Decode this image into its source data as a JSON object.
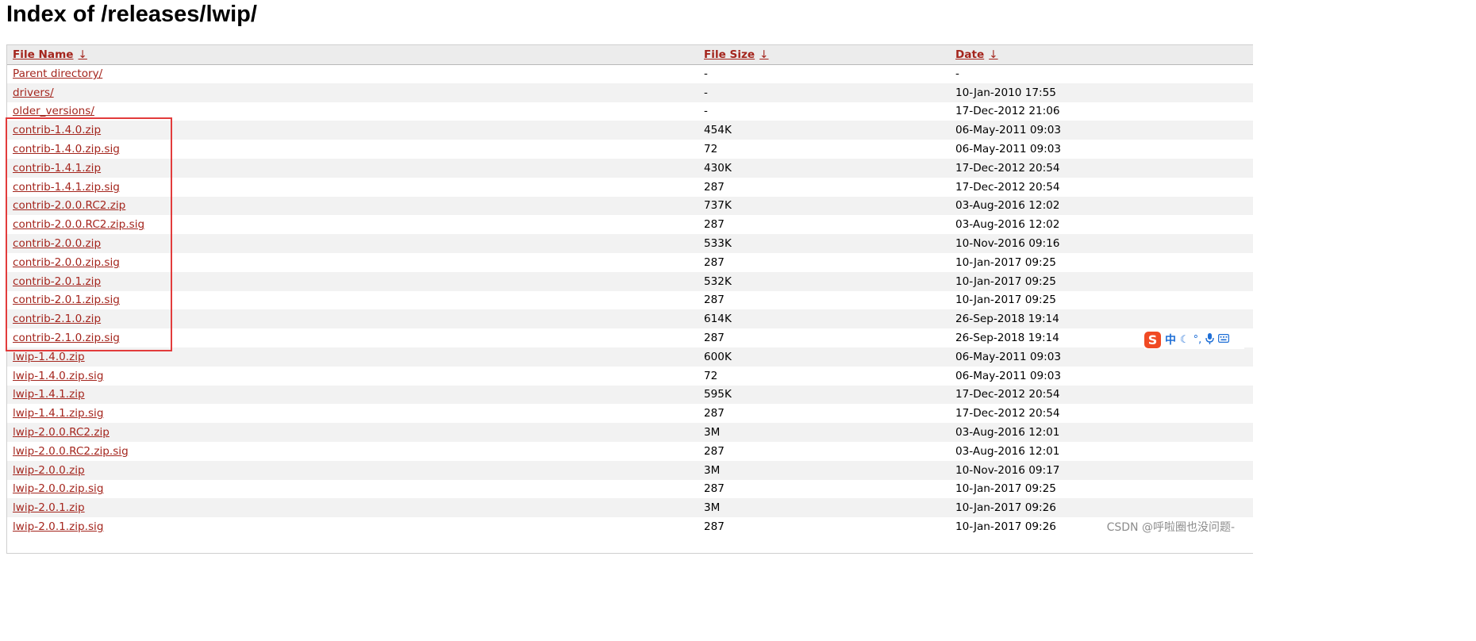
{
  "page": {
    "title": "Index of /releases/lwip/"
  },
  "table": {
    "headers": [
      {
        "label": "File Name",
        "arrow": "↓"
      },
      {
        "label": "File Size",
        "arrow": "↓"
      },
      {
        "label": "Date",
        "arrow": "↓"
      }
    ],
    "rows": [
      {
        "name": "Parent directory/",
        "size": "-",
        "date": "-"
      },
      {
        "name": "drivers/",
        "size": "-",
        "date": "10-Jan-2010 17:55"
      },
      {
        "name": "older_versions/",
        "size": "-",
        "date": "17-Dec-2012 21:06"
      },
      {
        "name": "contrib-1.4.0.zip",
        "size": "454K",
        "date": "06-May-2011 09:03"
      },
      {
        "name": "contrib-1.4.0.zip.sig",
        "size": "72",
        "date": "06-May-2011 09:03"
      },
      {
        "name": "contrib-1.4.1.zip",
        "size": "430K",
        "date": "17-Dec-2012 20:54"
      },
      {
        "name": "contrib-1.4.1.zip.sig",
        "size": "287",
        "date": "17-Dec-2012 20:54"
      },
      {
        "name": "contrib-2.0.0.RC2.zip",
        "size": "737K",
        "date": "03-Aug-2016 12:02"
      },
      {
        "name": "contrib-2.0.0.RC2.zip.sig",
        "size": "287",
        "date": "03-Aug-2016 12:02"
      },
      {
        "name": "contrib-2.0.0.zip",
        "size": "533K",
        "date": "10-Nov-2016 09:16"
      },
      {
        "name": "contrib-2.0.0.zip.sig",
        "size": "287",
        "date": "10-Jan-2017 09:25"
      },
      {
        "name": "contrib-2.0.1.zip",
        "size": "532K",
        "date": "10-Jan-2017 09:25"
      },
      {
        "name": "contrib-2.0.1.zip.sig",
        "size": "287",
        "date": "10-Jan-2017 09:25"
      },
      {
        "name": "contrib-2.1.0.zip",
        "size": "614K",
        "date": "26-Sep-2018 19:14"
      },
      {
        "name": "contrib-2.1.0.zip.sig",
        "size": "287",
        "date": "26-Sep-2018 19:14"
      },
      {
        "name": "lwip-1.4.0.zip",
        "size": "600K",
        "date": "06-May-2011 09:03"
      },
      {
        "name": "lwip-1.4.0.zip.sig",
        "size": "72",
        "date": "06-May-2011 09:03"
      },
      {
        "name": "lwip-1.4.1.zip",
        "size": "595K",
        "date": "17-Dec-2012 20:54"
      },
      {
        "name": "lwip-1.4.1.zip.sig",
        "size": "287",
        "date": "17-Dec-2012 20:54"
      },
      {
        "name": "lwip-2.0.0.RC2.zip",
        "size": "3M",
        "date": "03-Aug-2016 12:01"
      },
      {
        "name": "lwip-2.0.0.RC2.zip.sig",
        "size": "287",
        "date": "03-Aug-2016 12:01"
      },
      {
        "name": "lwip-2.0.0.zip",
        "size": "3M",
        "date": "10-Nov-2016 09:17"
      },
      {
        "name": "lwip-2.0.0.zip.sig",
        "size": "287",
        "date": "10-Jan-2017 09:25"
      },
      {
        "name": "lwip-2.0.1.zip",
        "size": "3M",
        "date": "10-Jan-2017 09:26"
      },
      {
        "name": "lwip-2.0.1.zip.sig",
        "size": "287",
        "date": "10-Jan-2017 09:26"
      }
    ]
  },
  "ime_toolbar": {
    "logo": "S",
    "lang": "中",
    "icons": [
      "moon-icon",
      "punctuation-icon",
      "microphone-icon",
      "keyboard-icon"
    ]
  },
  "watermark": "CSDN @呼啦圈也没问题-",
  "colors": {
    "link": "#a4251d",
    "highlight_box": "#e23c3c",
    "row_stripe": "#f2f2f2"
  }
}
